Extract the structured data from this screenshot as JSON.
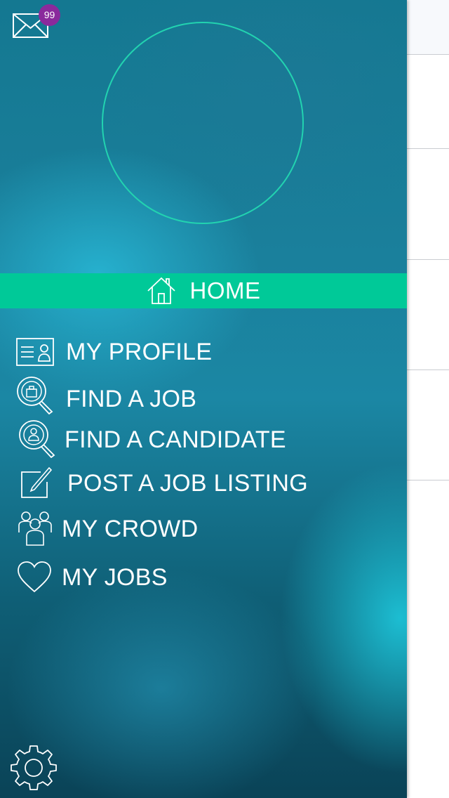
{
  "inbox": {
    "badge_count": "99"
  },
  "menu": {
    "home": "HOME",
    "items": [
      {
        "label": "MY PROFILE",
        "icon": "profile-card-icon"
      },
      {
        "label": "FIND A JOB",
        "icon": "search-job-icon"
      },
      {
        "label": "FIND A CANDIDATE",
        "icon": "search-candidate-icon"
      },
      {
        "label": "POST A JOB LISTING",
        "icon": "edit-note-icon"
      },
      {
        "label": "MY CROWD",
        "icon": "people-icon"
      },
      {
        "label": "MY JOBS",
        "icon": "heart-icon"
      }
    ]
  },
  "icons": {
    "mail": "mail-icon",
    "home": "home-icon",
    "settings": "gear-icon"
  },
  "colors": {
    "accent": "#00c998",
    "badge": "#8a2a9c",
    "avatar_ring": "#22d3b0"
  }
}
